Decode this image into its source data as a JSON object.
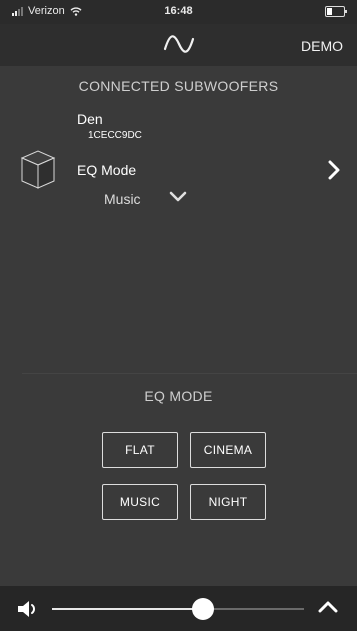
{
  "status_bar": {
    "carrier": "Verizon",
    "time": "16:48"
  },
  "header": {
    "logo_icon": "sine-wave-icon",
    "demo_label": "DEMO"
  },
  "connected": {
    "title": "CONNECTED SUBWOOFERS",
    "device": {
      "name": "Den",
      "id": "1CECC9DC",
      "eq_label": "EQ Mode",
      "eq_value": "Music"
    }
  },
  "eq_mode": {
    "title": "EQ MODE",
    "buttons": [
      "FLAT",
      "CINEMA",
      "MUSIC",
      "NIGHT"
    ]
  },
  "volume": {
    "level": 0.6
  },
  "colors": {
    "background": "#3a3a3a",
    "header": "#2e2e2e",
    "bottom_bar": "#262626"
  }
}
